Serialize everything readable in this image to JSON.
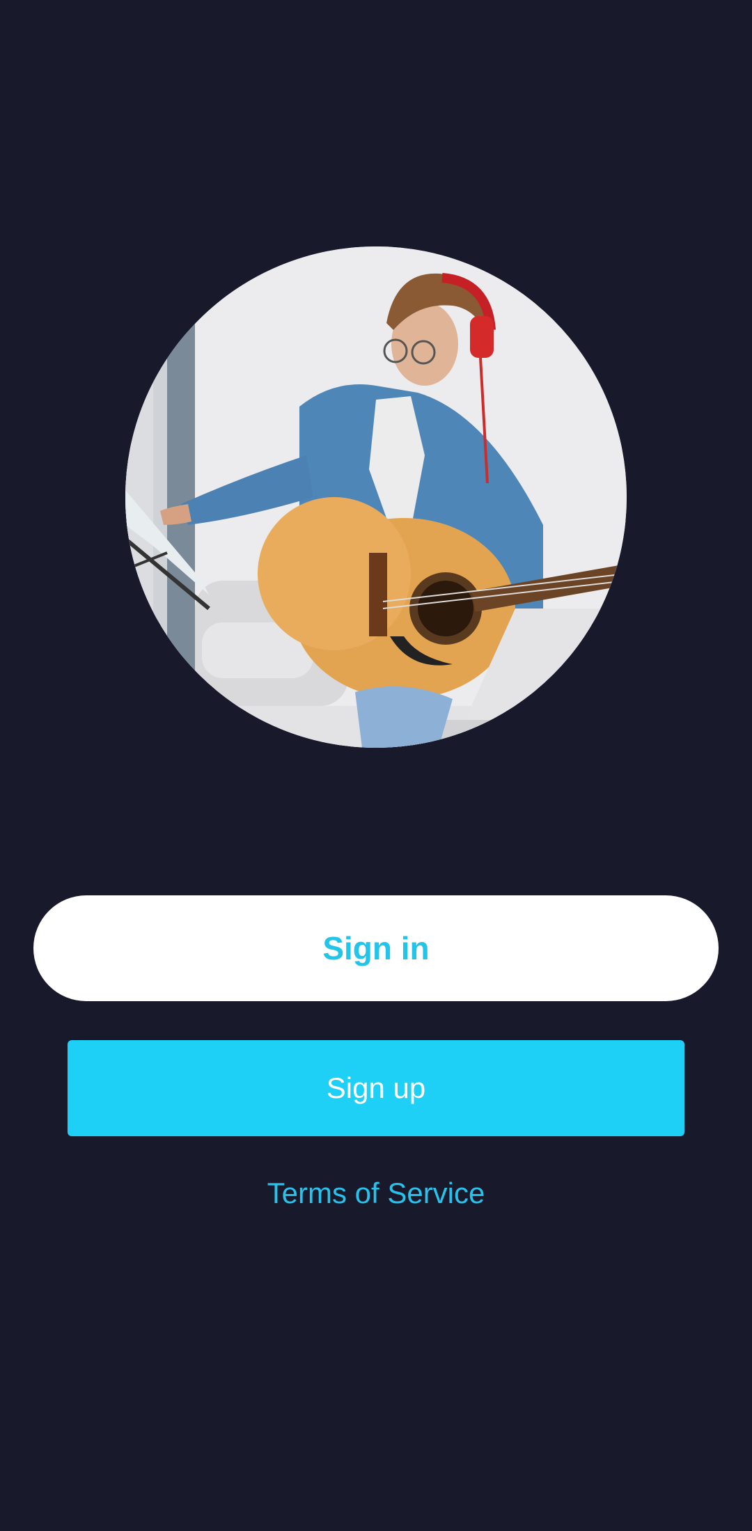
{
  "hero": {
    "image": "person-playing-acoustic-guitar-with-headphones"
  },
  "actions": {
    "sign_in_label": "Sign in",
    "sign_up_label": "Sign up",
    "terms_label": "Terms of Service"
  },
  "colors": {
    "background": "#181a2b",
    "accent": "#1ecff6",
    "accent_text": "#22c4ea",
    "white": "#ffffff"
  }
}
